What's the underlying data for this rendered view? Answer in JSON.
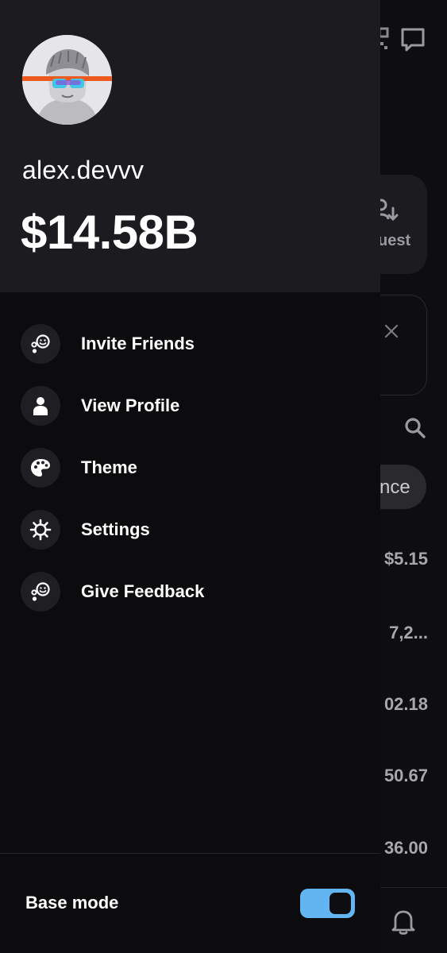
{
  "profile": {
    "username": "alex.devvv",
    "balance": "$14.58B"
  },
  "menu": {
    "items": [
      {
        "label": "Invite Friends",
        "icon": "invite-friends-icon"
      },
      {
        "label": "View Profile",
        "icon": "person-icon"
      },
      {
        "label": "Theme",
        "icon": "palette-icon"
      },
      {
        "label": "Settings",
        "icon": "gear-icon"
      },
      {
        "label": "Give Feedback",
        "icon": "feedback-icon"
      }
    ]
  },
  "footer": {
    "base_mode_label": "Base mode",
    "base_mode_enabled": true
  },
  "background": {
    "request_label": "uest",
    "pill_label": "nce",
    "amounts": [
      "$5.15",
      "7,2...",
      "02.18",
      "50.67",
      "36.00"
    ]
  },
  "colors": {
    "toggle_on": "#63b5f2",
    "drawer_header": "#1c1c20",
    "drawer_body": "#0c0c0e",
    "avatar_band": "#ee5a1e"
  }
}
